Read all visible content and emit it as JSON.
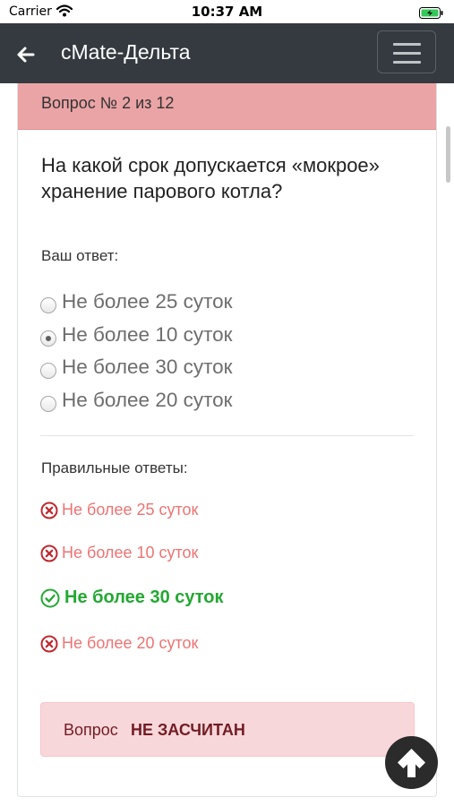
{
  "status_bar": {
    "carrier": "Carrier",
    "time": "10:37 AM"
  },
  "app_bar": {
    "title": "сMate-Дельта"
  },
  "card": {
    "header": "Вопрос № 2 из 12",
    "question": "На какой срок допускается «мокрое» хранение парового котла?",
    "answer_label": "Ваш ответ:",
    "options": [
      {
        "label": "Не более 25 суток",
        "selected": false
      },
      {
        "label": "Не более 10 суток",
        "selected": true
      },
      {
        "label": "Не более 30 суток",
        "selected": false
      },
      {
        "label": "Не более 20 суток",
        "selected": false
      }
    ],
    "correct_label": "Правильные ответы:",
    "results": [
      {
        "label": "Не более 25 суток",
        "status": "wrong"
      },
      {
        "label": "Не более 10 суток",
        "status": "wrong"
      },
      {
        "label": "Не более 30 суток",
        "status": "correct"
      },
      {
        "label": "Не более 20 суток",
        "status": "wrong"
      }
    ],
    "verdict": {
      "prefix": "Вопрос",
      "status": "НЕ ЗАСЧИТАН"
    }
  },
  "colors": {
    "app_bar": "#343a40",
    "header": "#eba4a6",
    "wrong": "#ee7373",
    "correct": "#23a832",
    "alert_bg": "#f8d7da",
    "alert_text": "#721c24"
  },
  "icons": {
    "back": "arrow-left-icon",
    "menu": "hamburger-icon",
    "wrong": "x-circle-icon",
    "correct": "check-circle-icon",
    "scroll_top": "arrow-up-icon"
  }
}
